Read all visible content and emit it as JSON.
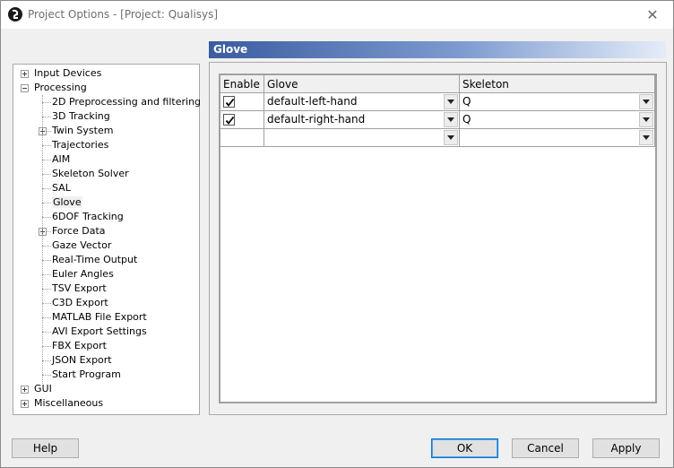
{
  "window": {
    "title": "Project Options - [Project: Qualisys]",
    "close_glyph": "✕",
    "app_icon": "qualisys-logo-icon"
  },
  "tree": {
    "items": [
      {
        "label": "Input Devices",
        "level": 0,
        "expander": true
      },
      {
        "label": "Processing",
        "level": 0,
        "expander": true,
        "expanded": true
      },
      {
        "label": "2D Preprocessing and filtering",
        "level": 1,
        "expander": false
      },
      {
        "label": "3D Tracking",
        "level": 1,
        "expander": false
      },
      {
        "label": "Twin System",
        "level": 1,
        "expander": true
      },
      {
        "label": "Trajectories",
        "level": 1,
        "expander": false
      },
      {
        "label": "AIM",
        "level": 1,
        "expander": false
      },
      {
        "label": "Skeleton Solver",
        "level": 1,
        "expander": false
      },
      {
        "label": "SAL",
        "level": 1,
        "expander": false
      },
      {
        "label": "Glove",
        "level": 1,
        "expander": false,
        "selected": true
      },
      {
        "label": "6DOF Tracking",
        "level": 1,
        "expander": false
      },
      {
        "label": "Force Data",
        "level": 1,
        "expander": true
      },
      {
        "label": "Gaze Vector",
        "level": 1,
        "expander": false
      },
      {
        "label": "Real-Time Output",
        "level": 1,
        "expander": false
      },
      {
        "label": "Euler Angles",
        "level": 1,
        "expander": false
      },
      {
        "label": "TSV Export",
        "level": 1,
        "expander": false
      },
      {
        "label": "C3D Export",
        "level": 1,
        "expander": false
      },
      {
        "label": "MATLAB File Export",
        "level": 1,
        "expander": false
      },
      {
        "label": "AVI Export Settings",
        "level": 1,
        "expander": false
      },
      {
        "label": "FBX Export",
        "level": 1,
        "expander": false
      },
      {
        "label": "JSON Export",
        "level": 1,
        "expander": false
      },
      {
        "label": "Start Program",
        "level": 1,
        "expander": false
      },
      {
        "label": "GUI",
        "level": 0,
        "expander": true
      },
      {
        "label": "Miscellaneous",
        "level": 0,
        "expander": true
      }
    ]
  },
  "page": {
    "header": "Glove"
  },
  "table": {
    "columns": [
      "Enable",
      "Glove",
      "Skeleton"
    ],
    "rows": [
      {
        "enabled": true,
        "glove": "default-left-hand",
        "skeleton": "Q"
      },
      {
        "enabled": true,
        "glove": "default-right-hand",
        "skeleton": "Q"
      },
      {
        "enabled": false,
        "glove": "",
        "skeleton": ""
      }
    ]
  },
  "buttons": {
    "help": "Help",
    "ok": "OK",
    "cancel": "Cancel",
    "apply": "Apply"
  }
}
